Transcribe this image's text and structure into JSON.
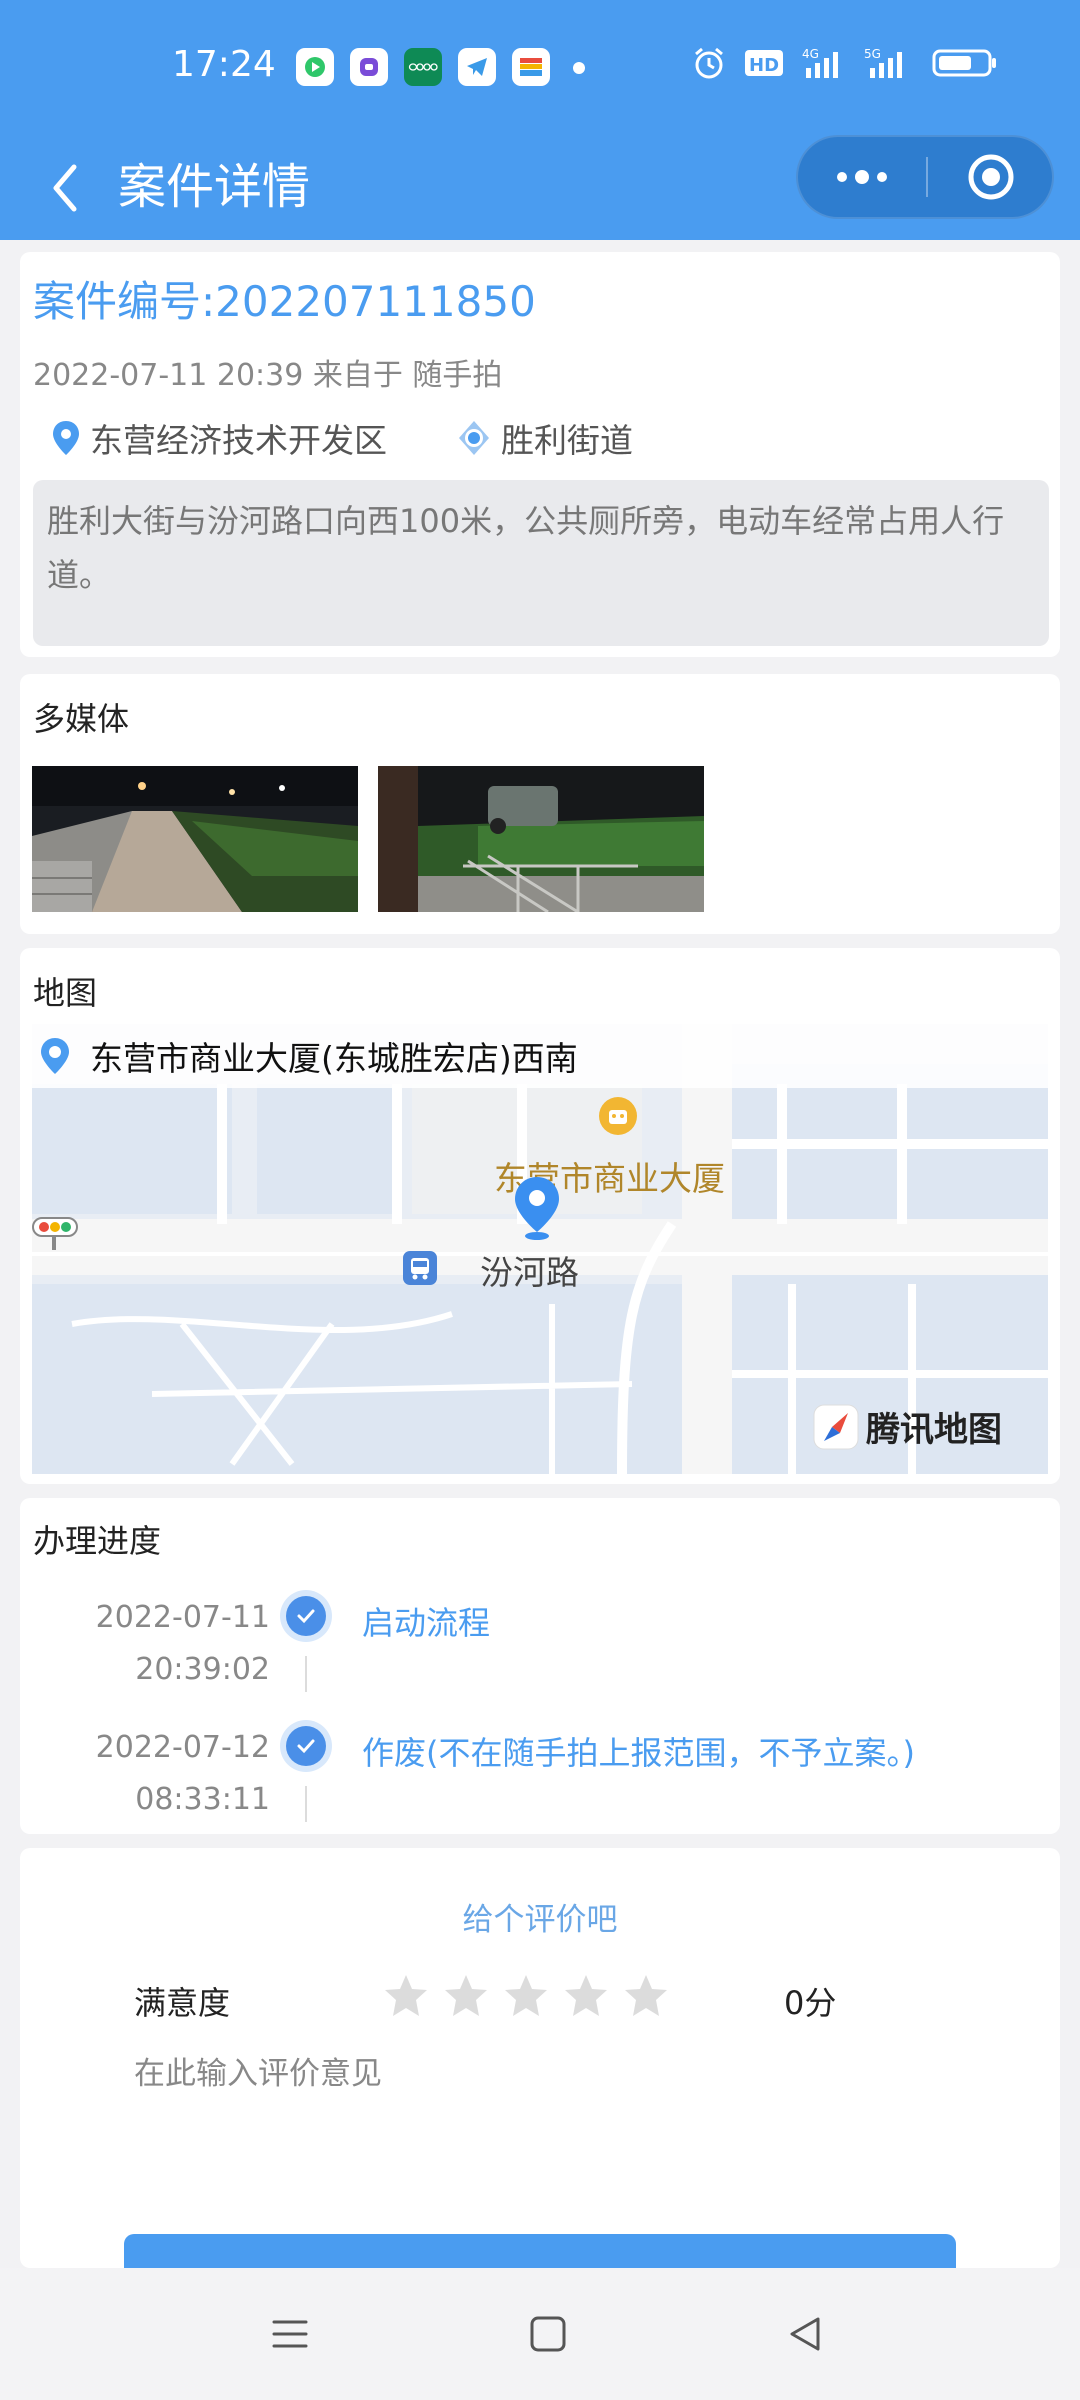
{
  "status_bar": {
    "time": "17:24",
    "app_icons": [
      "video-app-icon",
      "chat-app-icon",
      "oppo-icon",
      "telegram-icon",
      "wallet-icon"
    ],
    "system_icons": [
      "alarm-icon",
      "hd-icon",
      "signal-4g-icon",
      "signal-5g-icon",
      "battery-icon"
    ]
  },
  "header": {
    "title": "案件详情",
    "colors": {
      "bar": "#4a9cf0",
      "capsule": "#2e7dcf"
    }
  },
  "case": {
    "number": "案件编号:202207111850",
    "meta": "2022-07-11 20:39 来自于 随手拍",
    "district": "东营经济技术开发区",
    "street": "胜利街道",
    "description": "胜利大街与汾河路口向西100米，公共厕所旁，电动车经常占用人行道。"
  },
  "media": {
    "title": "多媒体",
    "photos": [
      "night-street-photo-1",
      "night-street-photo-2"
    ]
  },
  "map": {
    "title": "地图",
    "address": "东营市商业大厦(东城胜宏店)西南",
    "poi_label": "东营市商业大厦",
    "road_label": "汾河路",
    "brand": "腾讯地图"
  },
  "progress": {
    "title": "办理进度",
    "items": [
      {
        "date": "2022-07-11",
        "time": "20:39:02",
        "event": "启动流程"
      },
      {
        "date": "2022-07-12",
        "time": "08:33:11",
        "event": "作废(不在随手拍上报范围，不予立案。)"
      }
    ]
  },
  "evaluation": {
    "prompt": "给个评价吧",
    "rating_label": "满意度",
    "stars_total": 5,
    "stars_selected": 0,
    "score": "0分",
    "comment_placeholder": "在此输入评价意见"
  },
  "nav_bar": {
    "items": [
      "menu-icon",
      "home-icon",
      "back-icon"
    ]
  }
}
